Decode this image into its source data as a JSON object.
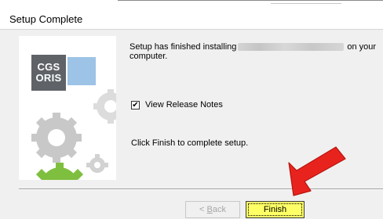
{
  "window": {
    "title": "Setup Complete"
  },
  "logo": {
    "line1": "CGS",
    "line2": "ORIS"
  },
  "message": {
    "prefix": "Setup has finished installing",
    "suffix": "on your",
    "line2": "computer."
  },
  "release_notes": {
    "label": "View Release Notes",
    "checked": true
  },
  "instruction": "Click Finish to complete setup.",
  "buttons": {
    "back_prefix": "< ",
    "back_accel": "B",
    "back_rest": "ack",
    "finish": "Finish"
  },
  "colors": {
    "finish_highlight": "#ffff66",
    "arrow": "#e8231e",
    "logo_gray": "#5f6368",
    "logo_blue": "#9dc3e6"
  },
  "icons": [
    "gear-icon",
    "checkbox-checked-icon",
    "red-arrow-icon"
  ]
}
